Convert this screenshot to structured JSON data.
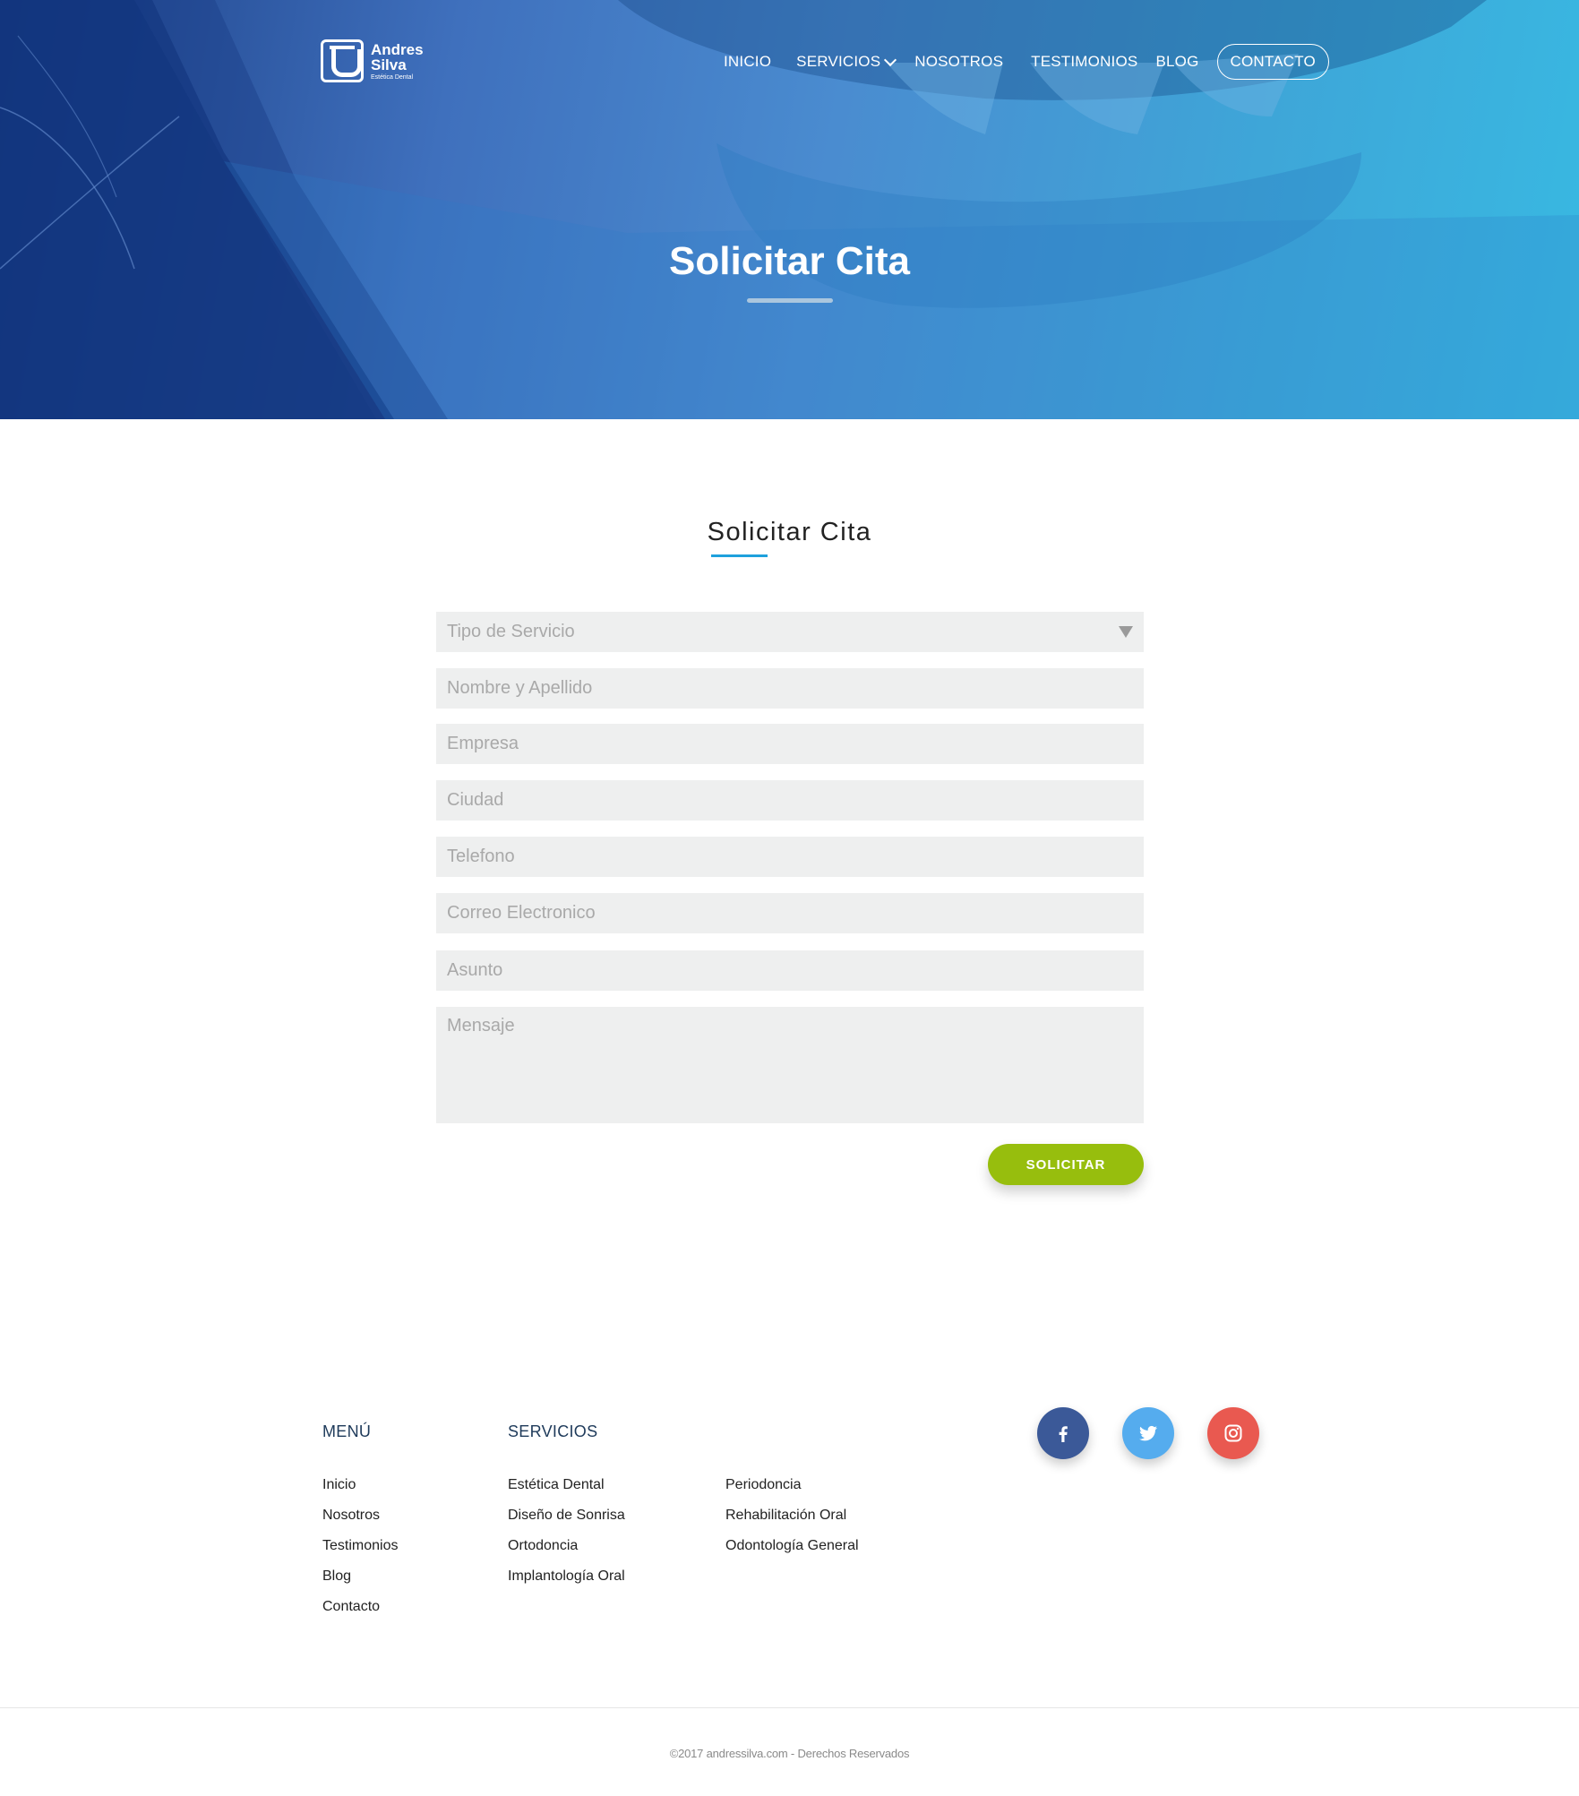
{
  "brand": {
    "name_line1": "Andres",
    "name_line2": "Silva",
    "tagline": "Estética Dental"
  },
  "nav": {
    "items": [
      "INICIO",
      "SERVICIOS",
      "NOSOTROS",
      "TESTIMONIOS",
      "BLOG"
    ],
    "contact": "CONTACTO"
  },
  "hero": {
    "title": "Solicitar Cita"
  },
  "form": {
    "title": "Solicitar Cita",
    "service_placeholder": "Tipo de Servicio",
    "name_placeholder": "Nombre y Apellido",
    "company_placeholder": "Empresa",
    "city_placeholder": "Ciudad",
    "phone_placeholder": "Telefono",
    "email_placeholder": "Correo Electronico",
    "subject_placeholder": "Asunto",
    "message_placeholder": "Mensaje",
    "submit_label": "SOLICITAR"
  },
  "footer": {
    "menu_heading": "MENÚ",
    "menu_items": [
      "Inicio",
      "Nosotros",
      "Testimonios",
      "Blog",
      "Contacto"
    ],
    "services_heading": "SERVICIOS",
    "services_col1": [
      "Estética Dental",
      "Diseño de Sonrisa",
      "Ortodoncia",
      "Implantología Oral"
    ],
    "services_col2": [
      "Periodoncia",
      "Rehabilitación Oral",
      "Odontología General"
    ],
    "social_icons": [
      "facebook-icon",
      "twitter-icon",
      "instagram-icon"
    ],
    "copyright": "©2017 andressilva.com - Derechos Reservados"
  },
  "colors": {
    "accent_blue": "#1ea1dc",
    "submit_green": "#97be0d",
    "facebook": "#3b5998",
    "twitter": "#55acee",
    "instagram": "#e95950"
  }
}
